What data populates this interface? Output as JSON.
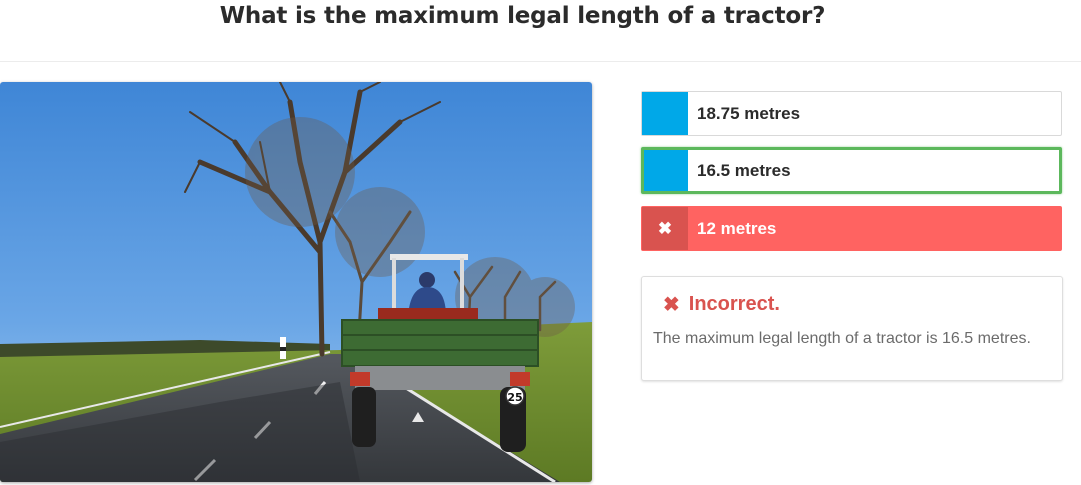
{
  "question": "What is the maximum legal length of a tractor?",
  "answers": [
    {
      "label": "18.75 metres",
      "state": "neutral",
      "swatch_color": "#00a8e8"
    },
    {
      "label": "16.5 metres",
      "state": "correct",
      "swatch_color": "#00a8e8",
      "highlight_color": "#5cb85c"
    },
    {
      "label": "12 metres",
      "state": "selected-incorrect",
      "icon": "cross-icon",
      "icon_glyph": "✖",
      "background_color": "#ff6361"
    }
  ],
  "feedback": {
    "title": "Incorrect.",
    "icon": "cross-icon",
    "icon_glyph": "✖",
    "message": "The maximum legal length of a tractor is 16.5 metres.",
    "color": "#d9534f"
  },
  "image": {
    "subject": "tractor-with-trailer-on-road",
    "plate_text": "25"
  }
}
